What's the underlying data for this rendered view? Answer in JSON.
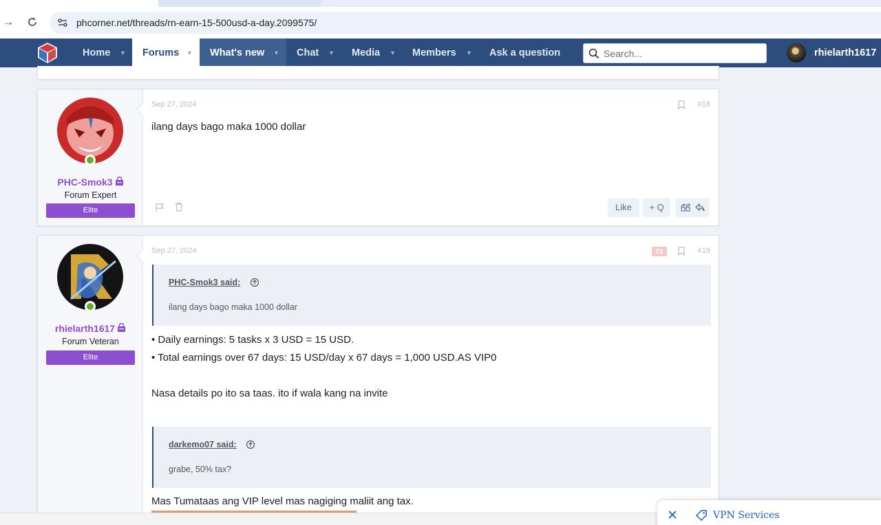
{
  "browser": {
    "url": "phcorner.net/threads/rn-earn-15-500usd-a-day.2099575/"
  },
  "nav": {
    "items": [
      {
        "label": "Home",
        "caret": "▼"
      },
      {
        "label": "Forums",
        "caret": "▼"
      },
      {
        "label": "What's new",
        "caret": "▼"
      },
      {
        "label": "Chat",
        "caret": "▼"
      },
      {
        "label": "Media",
        "caret": "▼"
      },
      {
        "label": "Members",
        "caret": "▼"
      },
      {
        "label": "Ask a question"
      }
    ],
    "search_placeholder": "Search...",
    "username": "rhielarth1617"
  },
  "posts": [
    {
      "username": "PHC-Smok3",
      "title": "Forum Expert",
      "banner": "Elite",
      "date": "Sep 27, 2024",
      "number": "#18",
      "body": "ilang days bago maka 1000 dollar",
      "like_label": "Like",
      "quote_label": "+ Q"
    },
    {
      "username": "rhielarth1617",
      "title": "Forum Veteran",
      "banner": "Elite",
      "date": "Sep 27, 2024",
      "number": "#19",
      "ts_badge": "TS",
      "quotes": [
        {
          "author": "PHC-Smok3 said:",
          "text": "ilang days bago maka 1000 dollar"
        },
        {
          "author": "darkemo07 said:",
          "text": "grabe, 50% tax?"
        }
      ],
      "lines": [
        "• Daily earnings: 5 tasks x 3 USD = 15 USD.",
        "• Total earnings over 67 days: 15 USD/day x 67 days = 1,000 USD.AS VIP0",
        "Nasa details po ito sa taas. ito if wala kang na invite",
        "Mas Tumataas ang VIP level mas nagiging maliit ang tax."
      ]
    }
  ],
  "vpn_popup": {
    "label": "VPN Services"
  },
  "colors": {
    "nav_bg": "#2d4d7e",
    "username": "#8f4fcb",
    "banner": "#8b4fd0",
    "online": "#63b12a"
  }
}
